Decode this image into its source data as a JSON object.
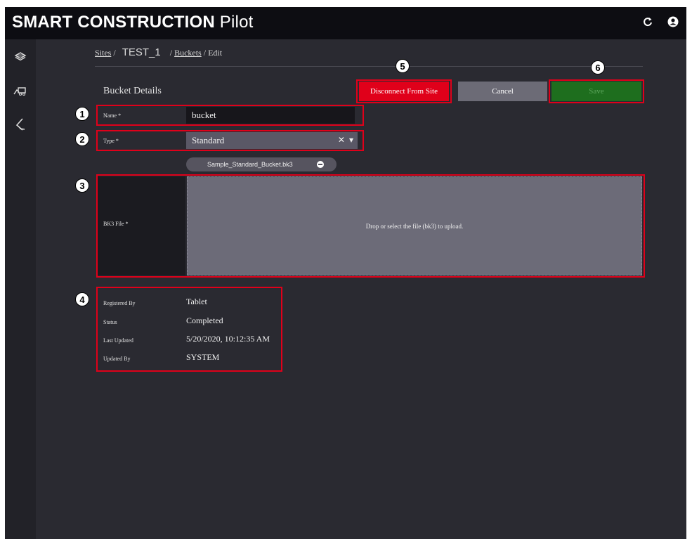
{
  "app": {
    "brand_bold": "SMART CONSTRUCTION",
    "brand_light": "Pilot",
    "icons": [
      "refresh-icon",
      "user-account-icon"
    ]
  },
  "sidebar": {
    "items": [
      {
        "icon": "layers-icon"
      },
      {
        "icon": "machine-icon"
      },
      {
        "icon": "bucket-arm-icon"
      }
    ]
  },
  "breadcrumb": {
    "sites": "Sites",
    "sep1": "/",
    "current": "TEST_1",
    "sep2": "/",
    "buckets": "Buckets",
    "sep3": "/",
    "edit": "Edit"
  },
  "form": {
    "section_title": "Bucket Details",
    "name_label": "Name *",
    "name_value": "bucket",
    "type_label": "Type *",
    "type_value": "Standard",
    "file_chip": "Sample_Standard_Bucket.bk3",
    "bk3_label": "BK3 File *",
    "dropzone_text": "Drop or select the file (bk3) to upload."
  },
  "buttons": {
    "disconnect": "Disconnect From Site",
    "cancel": "Cancel",
    "save": "Save"
  },
  "meta": {
    "registered_by_label": "Registered By",
    "registered_by_value": "Tablet",
    "status_label": "Status",
    "status_value": "Completed",
    "last_updated_label": "Last Updated",
    "last_updated_value": "5/20/2020, 10:12:35 AM",
    "updated_by_label": "Updated By",
    "updated_by_value": "SYSTEM"
  },
  "annotations": [
    "1",
    "2",
    "3",
    "4",
    "5",
    "6"
  ],
  "colors": {
    "highlight": "#e0001a",
    "disconnect_bg": "#e0001a",
    "save_bg": "#1e6e1e",
    "cancel_bg": "#6c6b76"
  }
}
